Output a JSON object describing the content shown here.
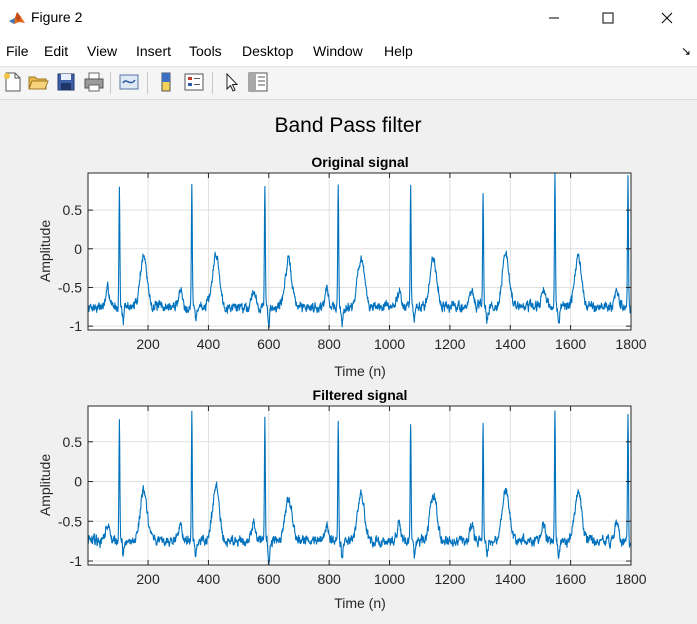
{
  "window": {
    "title": "Figure 2",
    "minimize_icon": "minimize-icon",
    "maximize_icon": "maximize-icon",
    "close_icon": "close-icon"
  },
  "menu": {
    "items": [
      "File",
      "Edit",
      "View",
      "Insert",
      "Tools",
      "Desktop",
      "Window",
      "Help"
    ]
  },
  "toolbar": {
    "icons": [
      "new-figure-icon",
      "open-file-icon",
      "save-icon",
      "print-icon",
      "link-plot-icon",
      "colorbar-icon",
      "legend-icon",
      "pointer-icon",
      "property-inspector-icon"
    ]
  },
  "figure": {
    "suptitle": "Band Pass filter",
    "line_color": "#0072bd"
  },
  "chart_data": [
    {
      "type": "line",
      "title": "Original signal",
      "xlabel": "Time (n)",
      "ylabel": "Amplitude",
      "xlim": [
        1,
        1800
      ],
      "ylim": [
        -1.05,
        0.98
      ],
      "xticks": [
        200,
        400,
        600,
        800,
        1000,
        1200,
        1400,
        1600,
        1800
      ],
      "yticks": [
        -1,
        -0.5,
        0,
        0.5
      ],
      "ytick_labels": [
        "-1",
        "-0.5",
        "0",
        "0.5"
      ],
      "grid": true,
      "series": [
        {
          "baseline": -0.75,
          "r_peaks": [
            {
              "x": 105,
              "y": 0.8
            },
            {
              "x": 345,
              "y": 0.82
            },
            {
              "x": 587,
              "y": 0.8
            },
            {
              "x": 830,
              "y": 0.8
            },
            {
              "x": 1070,
              "y": 0.78
            },
            {
              "x": 1310,
              "y": 0.75
            },
            {
              "x": 1548,
              "y": 0.98
            },
            {
              "x": 1790,
              "y": 0.87
            }
          ],
          "t_waves": [
            {
              "x": 185,
              "y": -0.1
            },
            {
              "x": 425,
              "y": -0.07
            },
            {
              "x": 665,
              "y": -0.18
            },
            {
              "x": 905,
              "y": -0.12
            },
            {
              "x": 1145,
              "y": -0.12
            },
            {
              "x": 1385,
              "y": -0.08
            },
            {
              "x": 1625,
              "y": -0.12
            }
          ],
          "s_dips": [
            {
              "x": 118,
              "y": -0.95
            },
            {
              "x": 358,
              "y": -0.92
            },
            {
              "x": 600,
              "y": -1.05
            },
            {
              "x": 843,
              "y": -1.0
            },
            {
              "x": 1083,
              "y": -0.93
            },
            {
              "x": 1323,
              "y": -0.92
            },
            {
              "x": 1561,
              "y": -0.95
            }
          ]
        }
      ]
    },
    {
      "type": "line",
      "title": "Filtered signal",
      "xlabel": "Time (n)",
      "ylabel": "Amplitude",
      "xlim": [
        1,
        1800
      ],
      "ylim": [
        -1.05,
        0.95
      ],
      "xticks": [
        200,
        400,
        600,
        800,
        1000,
        1200,
        1400,
        1600,
        1800
      ],
      "yticks": [
        -1,
        -0.5,
        0,
        0.5
      ],
      "ytick_labels": [
        "-1",
        "-0.5",
        "0",
        "0.5"
      ],
      "grid": true,
      "series": [
        {
          "baseline": -0.75,
          "r_peaks": [
            {
              "x": 105,
              "y": 0.74
            },
            {
              "x": 345,
              "y": 0.85
            },
            {
              "x": 587,
              "y": 0.78
            },
            {
              "x": 830,
              "y": 0.75
            },
            {
              "x": 1070,
              "y": 0.75
            },
            {
              "x": 1310,
              "y": 0.72
            },
            {
              "x": 1548,
              "y": 0.95
            },
            {
              "x": 1790,
              "y": 0.85
            }
          ],
          "t_waves": [
            {
              "x": 185,
              "y": -0.12
            },
            {
              "x": 425,
              "y": -0.05
            },
            {
              "x": 665,
              "y": -0.2
            },
            {
              "x": 905,
              "y": -0.15
            },
            {
              "x": 1145,
              "y": -0.15
            },
            {
              "x": 1385,
              "y": -0.1
            },
            {
              "x": 1625,
              "y": -0.15
            }
          ],
          "s_dips": [
            {
              "x": 118,
              "y": -0.95
            },
            {
              "x": 358,
              "y": -0.95
            },
            {
              "x": 600,
              "y": -1.05
            },
            {
              "x": 843,
              "y": -1.0
            },
            {
              "x": 1083,
              "y": -0.95
            },
            {
              "x": 1323,
              "y": -0.95
            },
            {
              "x": 1561,
              "y": -0.95
            }
          ]
        }
      ]
    }
  ]
}
